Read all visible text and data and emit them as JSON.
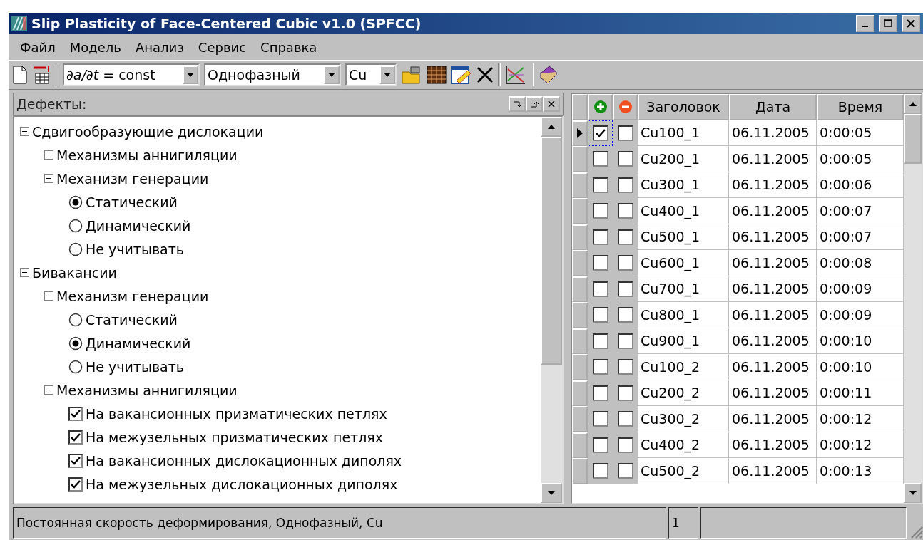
{
  "window": {
    "title": "Slip Plasticity of Face-Centered Cubic v1.0 (SPFCC)"
  },
  "menu": [
    "Файл",
    "Модель",
    "Анализ",
    "Сервис",
    "Справка"
  ],
  "toolbar": {
    "combos": [
      {
        "value": "*∂a/∂t*  = const"
      },
      {
        "value": "Однофазный"
      },
      {
        "value": "Cu"
      }
    ]
  },
  "defects_panel": {
    "title": "Дефекты:",
    "tree": [
      {
        "kind": "folder",
        "label": "Сдвигообразующие дислокации",
        "expanded": true,
        "children": [
          {
            "kind": "folder",
            "label": "Механизмы аннигиляции",
            "expanded": false
          },
          {
            "kind": "folder",
            "label": "Механизм генерации",
            "expanded": true,
            "children": [
              {
                "kind": "radio",
                "label": "Статический",
                "selected": true
              },
              {
                "kind": "radio",
                "label": "Динамический",
                "selected": false
              },
              {
                "kind": "radio",
                "label": "Не учитывать",
                "selected": false
              }
            ]
          }
        ]
      },
      {
        "kind": "folder",
        "label": "Бивакансии",
        "expanded": true,
        "children": [
          {
            "kind": "folder",
            "label": "Механизм генерации",
            "expanded": true,
            "children": [
              {
                "kind": "radio",
                "label": "Статический",
                "selected": false
              },
              {
                "kind": "radio",
                "label": "Динамический",
                "selected": true
              },
              {
                "kind": "radio",
                "label": "Не учитывать",
                "selected": false
              }
            ]
          },
          {
            "kind": "folder",
            "label": "Механизмы аннигиляции",
            "expanded": true,
            "children": [
              {
                "kind": "check",
                "label": "На вакансионных призматических петлях",
                "checked": true
              },
              {
                "kind": "check",
                "label": "На межузельных призматических петлях",
                "checked": true
              },
              {
                "kind": "check",
                "label": "На вакансионных дислокационных диполях",
                "checked": true
              },
              {
                "kind": "check",
                "label": "На межузельных дислокационных диполях",
                "checked": true
              }
            ]
          }
        ]
      }
    ]
  },
  "table": {
    "columns": [
      "Заголовок",
      "Дата",
      "Время"
    ],
    "rows": [
      {
        "add": true,
        "remove": false,
        "title": "Cu100_1",
        "date": "06.11.2005",
        "time": "0:00:05",
        "selected": true
      },
      {
        "add": false,
        "remove": false,
        "title": "Cu200_1",
        "date": "06.11.2005",
        "time": "0:00:05",
        "selected": false
      },
      {
        "add": false,
        "remove": false,
        "title": "Cu300_1",
        "date": "06.11.2005",
        "time": "0:00:06",
        "selected": false
      },
      {
        "add": false,
        "remove": false,
        "title": "Cu400_1",
        "date": "06.11.2005",
        "time": "0:00:07",
        "selected": false
      },
      {
        "add": false,
        "remove": false,
        "title": "Cu500_1",
        "date": "06.11.2005",
        "time": "0:00:07",
        "selected": false
      },
      {
        "add": false,
        "remove": false,
        "title": "Cu600_1",
        "date": "06.11.2005",
        "time": "0:00:08",
        "selected": false
      },
      {
        "add": false,
        "remove": false,
        "title": "Cu700_1",
        "date": "06.11.2005",
        "time": "0:00:09",
        "selected": false
      },
      {
        "add": false,
        "remove": false,
        "title": "Cu800_1",
        "date": "06.11.2005",
        "time": "0:00:09",
        "selected": false
      },
      {
        "add": false,
        "remove": false,
        "title": "Cu900_1",
        "date": "06.11.2005",
        "time": "0:00:10",
        "selected": false
      },
      {
        "add": false,
        "remove": false,
        "title": "Cu100_2",
        "date": "06.11.2005",
        "time": "0:00:10",
        "selected": false
      },
      {
        "add": false,
        "remove": false,
        "title": "Cu200_2",
        "date": "06.11.2005",
        "time": "0:00:11",
        "selected": false
      },
      {
        "add": false,
        "remove": false,
        "title": "Cu300_2",
        "date": "06.11.2005",
        "time": "0:00:12",
        "selected": false
      },
      {
        "add": false,
        "remove": false,
        "title": "Cu400_2",
        "date": "06.11.2005",
        "time": "0:00:12",
        "selected": false
      },
      {
        "add": false,
        "remove": false,
        "title": "Cu500_2",
        "date": "06.11.2005",
        "time": "0:00:13",
        "selected": false
      }
    ]
  },
  "status_bar": {
    "text": "Постоянная скорость деформирования, Однофазный, Cu",
    "count": "1"
  }
}
